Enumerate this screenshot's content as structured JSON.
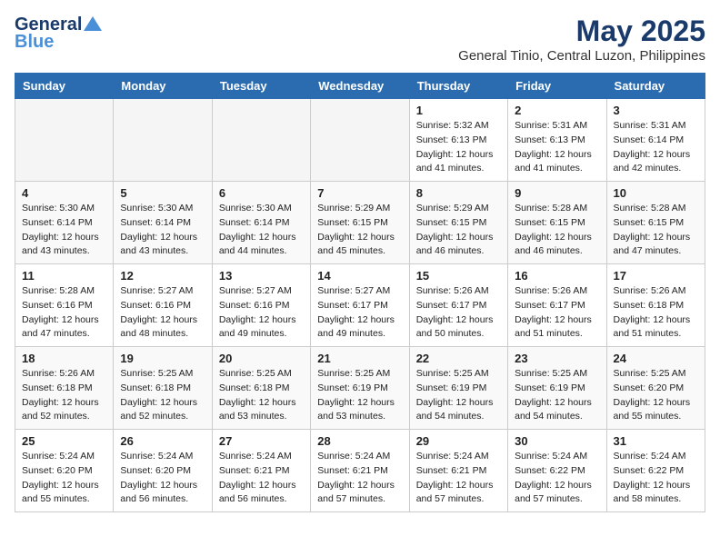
{
  "header": {
    "logo_line1": "General",
    "logo_line2": "Blue",
    "main_title": "May 2025",
    "subtitle": "General Tinio, Central Luzon, Philippines"
  },
  "days_of_week": [
    "Sunday",
    "Monday",
    "Tuesday",
    "Wednesday",
    "Thursday",
    "Friday",
    "Saturday"
  ],
  "weeks": [
    [
      {
        "day": "",
        "empty": true
      },
      {
        "day": "",
        "empty": true
      },
      {
        "day": "",
        "empty": true
      },
      {
        "day": "",
        "empty": true
      },
      {
        "day": "1",
        "sunrise": "5:32 AM",
        "sunset": "6:13 PM",
        "daylight": "12 hours and 41 minutes."
      },
      {
        "day": "2",
        "sunrise": "5:31 AM",
        "sunset": "6:13 PM",
        "daylight": "12 hours and 41 minutes."
      },
      {
        "day": "3",
        "sunrise": "5:31 AM",
        "sunset": "6:14 PM",
        "daylight": "12 hours and 42 minutes."
      }
    ],
    [
      {
        "day": "4",
        "sunrise": "5:30 AM",
        "sunset": "6:14 PM",
        "daylight": "12 hours and 43 minutes."
      },
      {
        "day": "5",
        "sunrise": "5:30 AM",
        "sunset": "6:14 PM",
        "daylight": "12 hours and 43 minutes."
      },
      {
        "day": "6",
        "sunrise": "5:30 AM",
        "sunset": "6:14 PM",
        "daylight": "12 hours and 44 minutes."
      },
      {
        "day": "7",
        "sunrise": "5:29 AM",
        "sunset": "6:15 PM",
        "daylight": "12 hours and 45 minutes."
      },
      {
        "day": "8",
        "sunrise": "5:29 AM",
        "sunset": "6:15 PM",
        "daylight": "12 hours and 46 minutes."
      },
      {
        "day": "9",
        "sunrise": "5:28 AM",
        "sunset": "6:15 PM",
        "daylight": "12 hours and 46 minutes."
      },
      {
        "day": "10",
        "sunrise": "5:28 AM",
        "sunset": "6:15 PM",
        "daylight": "12 hours and 47 minutes."
      }
    ],
    [
      {
        "day": "11",
        "sunrise": "5:28 AM",
        "sunset": "6:16 PM",
        "daylight": "12 hours and 47 minutes."
      },
      {
        "day": "12",
        "sunrise": "5:27 AM",
        "sunset": "6:16 PM",
        "daylight": "12 hours and 48 minutes."
      },
      {
        "day": "13",
        "sunrise": "5:27 AM",
        "sunset": "6:16 PM",
        "daylight": "12 hours and 49 minutes."
      },
      {
        "day": "14",
        "sunrise": "5:27 AM",
        "sunset": "6:17 PM",
        "daylight": "12 hours and 49 minutes."
      },
      {
        "day": "15",
        "sunrise": "5:26 AM",
        "sunset": "6:17 PM",
        "daylight": "12 hours and 50 minutes."
      },
      {
        "day": "16",
        "sunrise": "5:26 AM",
        "sunset": "6:17 PM",
        "daylight": "12 hours and 51 minutes."
      },
      {
        "day": "17",
        "sunrise": "5:26 AM",
        "sunset": "6:18 PM",
        "daylight": "12 hours and 51 minutes."
      }
    ],
    [
      {
        "day": "18",
        "sunrise": "5:26 AM",
        "sunset": "6:18 PM",
        "daylight": "12 hours and 52 minutes."
      },
      {
        "day": "19",
        "sunrise": "5:25 AM",
        "sunset": "6:18 PM",
        "daylight": "12 hours and 52 minutes."
      },
      {
        "day": "20",
        "sunrise": "5:25 AM",
        "sunset": "6:18 PM",
        "daylight": "12 hours and 53 minutes."
      },
      {
        "day": "21",
        "sunrise": "5:25 AM",
        "sunset": "6:19 PM",
        "daylight": "12 hours and 53 minutes."
      },
      {
        "day": "22",
        "sunrise": "5:25 AM",
        "sunset": "6:19 PM",
        "daylight": "12 hours and 54 minutes."
      },
      {
        "day": "23",
        "sunrise": "5:25 AM",
        "sunset": "6:19 PM",
        "daylight": "12 hours and 54 minutes."
      },
      {
        "day": "24",
        "sunrise": "5:25 AM",
        "sunset": "6:20 PM",
        "daylight": "12 hours and 55 minutes."
      }
    ],
    [
      {
        "day": "25",
        "sunrise": "5:24 AM",
        "sunset": "6:20 PM",
        "daylight": "12 hours and 55 minutes."
      },
      {
        "day": "26",
        "sunrise": "5:24 AM",
        "sunset": "6:20 PM",
        "daylight": "12 hours and 56 minutes."
      },
      {
        "day": "27",
        "sunrise": "5:24 AM",
        "sunset": "6:21 PM",
        "daylight": "12 hours and 56 minutes."
      },
      {
        "day": "28",
        "sunrise": "5:24 AM",
        "sunset": "6:21 PM",
        "daylight": "12 hours and 57 minutes."
      },
      {
        "day": "29",
        "sunrise": "5:24 AM",
        "sunset": "6:21 PM",
        "daylight": "12 hours and 57 minutes."
      },
      {
        "day": "30",
        "sunrise": "5:24 AM",
        "sunset": "6:22 PM",
        "daylight": "12 hours and 57 minutes."
      },
      {
        "day": "31",
        "sunrise": "5:24 AM",
        "sunset": "6:22 PM",
        "daylight": "12 hours and 58 minutes."
      }
    ]
  ],
  "labels": {
    "sunrise": "Sunrise:",
    "sunset": "Sunset:",
    "daylight": "Daylight:"
  }
}
